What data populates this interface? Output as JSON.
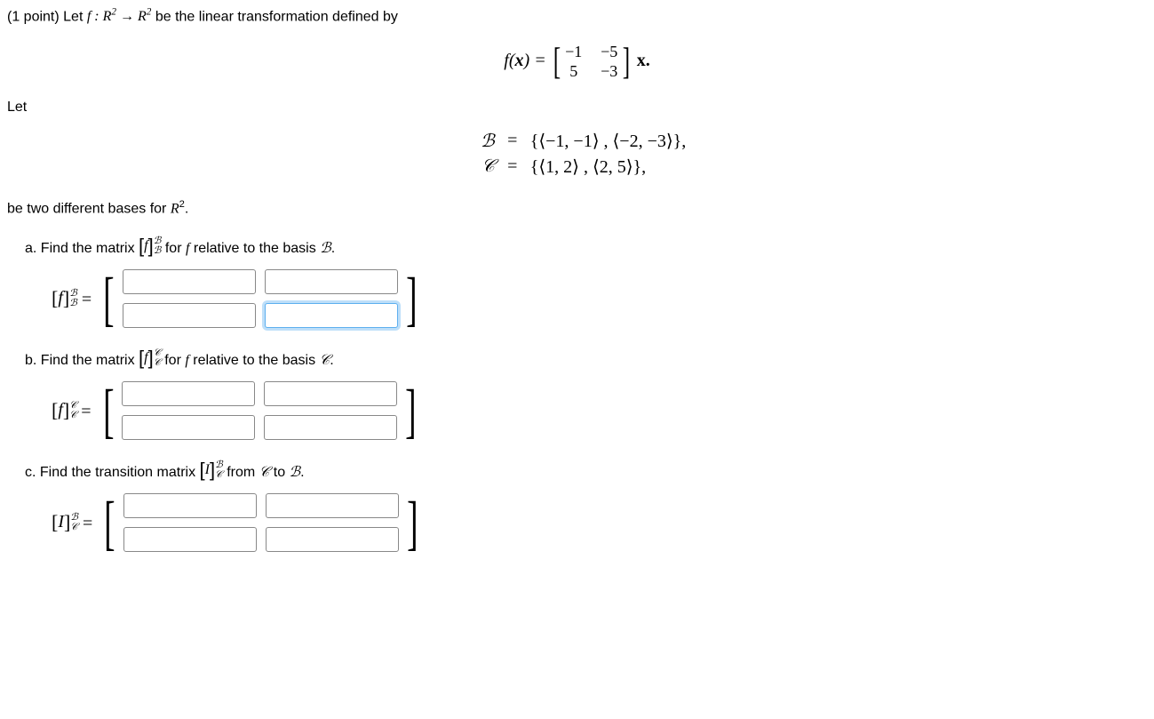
{
  "intro": {
    "points": "(1 point)",
    "text1": "Let ",
    "func": "f : R² → R²",
    "text2": " be the linear transformation defined by"
  },
  "equation": {
    "fx": "f(x) = ",
    "matrix": {
      "a11": "−1",
      "a12": "−5",
      "a21": "5",
      "a22": "−3"
    },
    "suffix": " x."
  },
  "let": "Let",
  "basisB": {
    "symbol": "ℬ",
    "eq": "=",
    "set": "{⟨−1, −1⟩ , ⟨−2, −3⟩},"
  },
  "basisC": {
    "symbol": "𝒞",
    "eq": "=",
    "set": "{⟨1, 2⟩ , ⟨2, 5⟩},"
  },
  "footer": "be two different bases for R².",
  "partA": {
    "text": "a. Find the matrix [f]ᴮʙ for f relative to the basis ℬ.",
    "label_f": "f",
    "label_sup": "ℬ",
    "label_sub": "ℬ"
  },
  "partB": {
    "text": "b. Find the matrix [f]ᶜᴄ for f relative to the basis 𝒞.",
    "label_f": "f",
    "label_sup": "𝒞",
    "label_sub": "𝒞"
  },
  "partC": {
    "text": "c. Find the transition matrix [I]ᴮᴄ from 𝒞 to ℬ.",
    "label_f": "I",
    "label_sup": "ℬ",
    "label_sub": "𝒞"
  }
}
